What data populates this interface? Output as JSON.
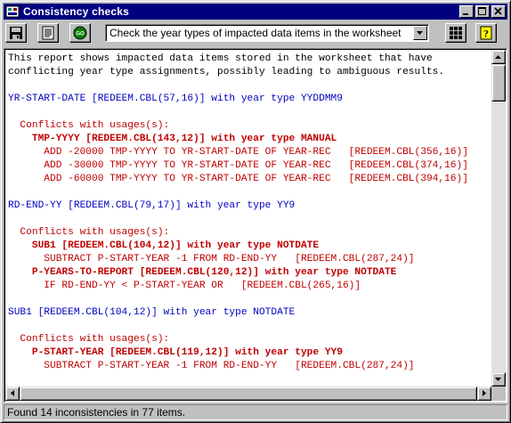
{
  "window": {
    "title": "Consistency checks"
  },
  "toolbar": {
    "buttons": [
      {
        "name": "save-icon"
      },
      {
        "name": "print-icon"
      },
      {
        "name": "go-icon",
        "label": "GO"
      }
    ],
    "combo": {
      "selected": "Check the year types of impacted data items in the worksheet"
    },
    "right_buttons": [
      {
        "name": "grid-icon"
      },
      {
        "name": "help-icon",
        "label": "?"
      }
    ]
  },
  "report": {
    "lines": [
      {
        "text": "This report shows impacted data items stored in the worksheet that have",
        "style": "plain"
      },
      {
        "text": "conflicting year type assignments, possibly leading to ambiguous results.",
        "style": "plain"
      },
      {
        "text": "",
        "style": "plain"
      },
      {
        "text": "YR-START-DATE [REDEEM.CBL(57,16)] with year type YYDDMM9",
        "style": "blue"
      },
      {
        "text": "",
        "style": "plain"
      },
      {
        "text": "  Conflicts with usages(s):",
        "style": "red"
      },
      {
        "text": "    TMP-YYYY [REDEEM.CBL(143,12)] with year type MANUAL",
        "style": "red-bold"
      },
      {
        "text": "      ADD -20000 TMP-YYYY TO YR-START-DATE OF YEAR-REC   [REDEEM.CBL(356,16)]",
        "style": "red"
      },
      {
        "text": "      ADD -30000 TMP-YYYY TO YR-START-DATE OF YEAR-REC   [REDEEM.CBL(374,16)]",
        "style": "red"
      },
      {
        "text": "      ADD -60000 TMP-YYYY TO YR-START-DATE OF YEAR-REC   [REDEEM.CBL(394,16)]",
        "style": "red"
      },
      {
        "text": "",
        "style": "plain"
      },
      {
        "text": "RD-END-YY [REDEEM.CBL(79,17)] with year type YY9",
        "style": "blue"
      },
      {
        "text": "",
        "style": "plain"
      },
      {
        "text": "  Conflicts with usages(s):",
        "style": "red"
      },
      {
        "text": "    SUB1 [REDEEM.CBL(104,12)] with year type NOTDATE",
        "style": "red-bold"
      },
      {
        "text": "      SUBTRACT P-START-YEAR -1 FROM RD-END-YY   [REDEEM.CBL(287,24)]",
        "style": "red"
      },
      {
        "text": "    P-YEARS-TO-REPORT [REDEEM.CBL(120,12)] with year type NOTDATE",
        "style": "red-bold"
      },
      {
        "text": "      IF RD-END-YY < P-START-YEAR OR   [REDEEM.CBL(265,16)]",
        "style": "red"
      },
      {
        "text": "",
        "style": "plain"
      },
      {
        "text": "SUB1 [REDEEM.CBL(104,12)] with year type NOTDATE",
        "style": "blue"
      },
      {
        "text": "",
        "style": "plain"
      },
      {
        "text": "  Conflicts with usages(s):",
        "style": "red"
      },
      {
        "text": "    P-START-YEAR [REDEEM.CBL(119,12)] with year type YY9",
        "style": "red-bold"
      },
      {
        "text": "      SUBTRACT P-START-YEAR -1 FROM RD-END-YY   [REDEEM.CBL(287,24)]",
        "style": "red"
      }
    ]
  },
  "status": {
    "text": "Found 14 inconsistencies in 77 items."
  },
  "colors": {
    "title_bar": "#000080",
    "heading_blue": "#0000c0",
    "conflict_red": "#c00000"
  }
}
